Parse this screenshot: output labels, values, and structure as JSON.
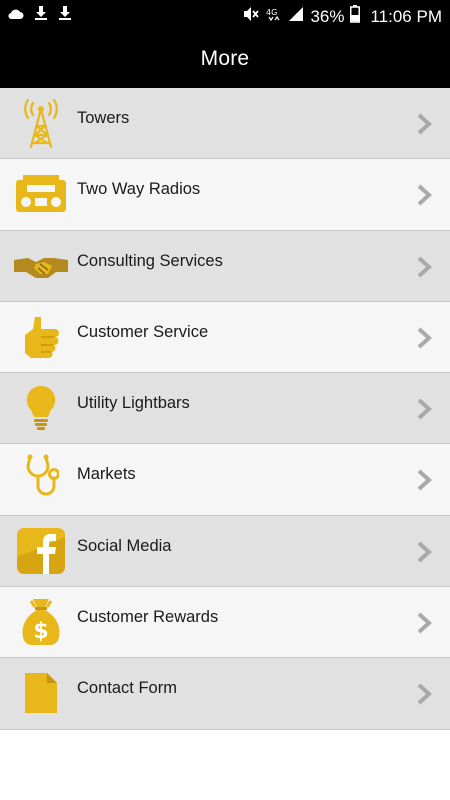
{
  "status_bar": {
    "battery_percent": "36%",
    "time": "11:06 PM",
    "icons": [
      "cloud-icon",
      "download-icon",
      "download-icon",
      "mute-icon",
      "4g-icon",
      "signal-icon",
      "battery-icon"
    ]
  },
  "header": {
    "title": "More"
  },
  "colors": {
    "accent_gold": "#e8b81a",
    "header_bg": "#000000",
    "row_shade": "#e1e1e1",
    "row_light": "#f6f6f6",
    "chevron": "#a9a9a9"
  },
  "menu": {
    "items": [
      {
        "label": "Towers",
        "icon": "tower-icon"
      },
      {
        "label": "Two Way Radios",
        "icon": "radio-icon"
      },
      {
        "label": "Consulting Services",
        "icon": "handshake-icon"
      },
      {
        "label": "Customer Service",
        "icon": "thumbs-up-icon"
      },
      {
        "label": "Utility Lightbars",
        "icon": "lightbulb-icon"
      },
      {
        "label": "Markets",
        "icon": "stethoscope-icon"
      },
      {
        "label": "Social Media",
        "icon": "facebook-icon"
      },
      {
        "label": "Customer Rewards",
        "icon": "money-bag-icon"
      },
      {
        "label": "Contact Form",
        "icon": "document-icon"
      }
    ]
  }
}
